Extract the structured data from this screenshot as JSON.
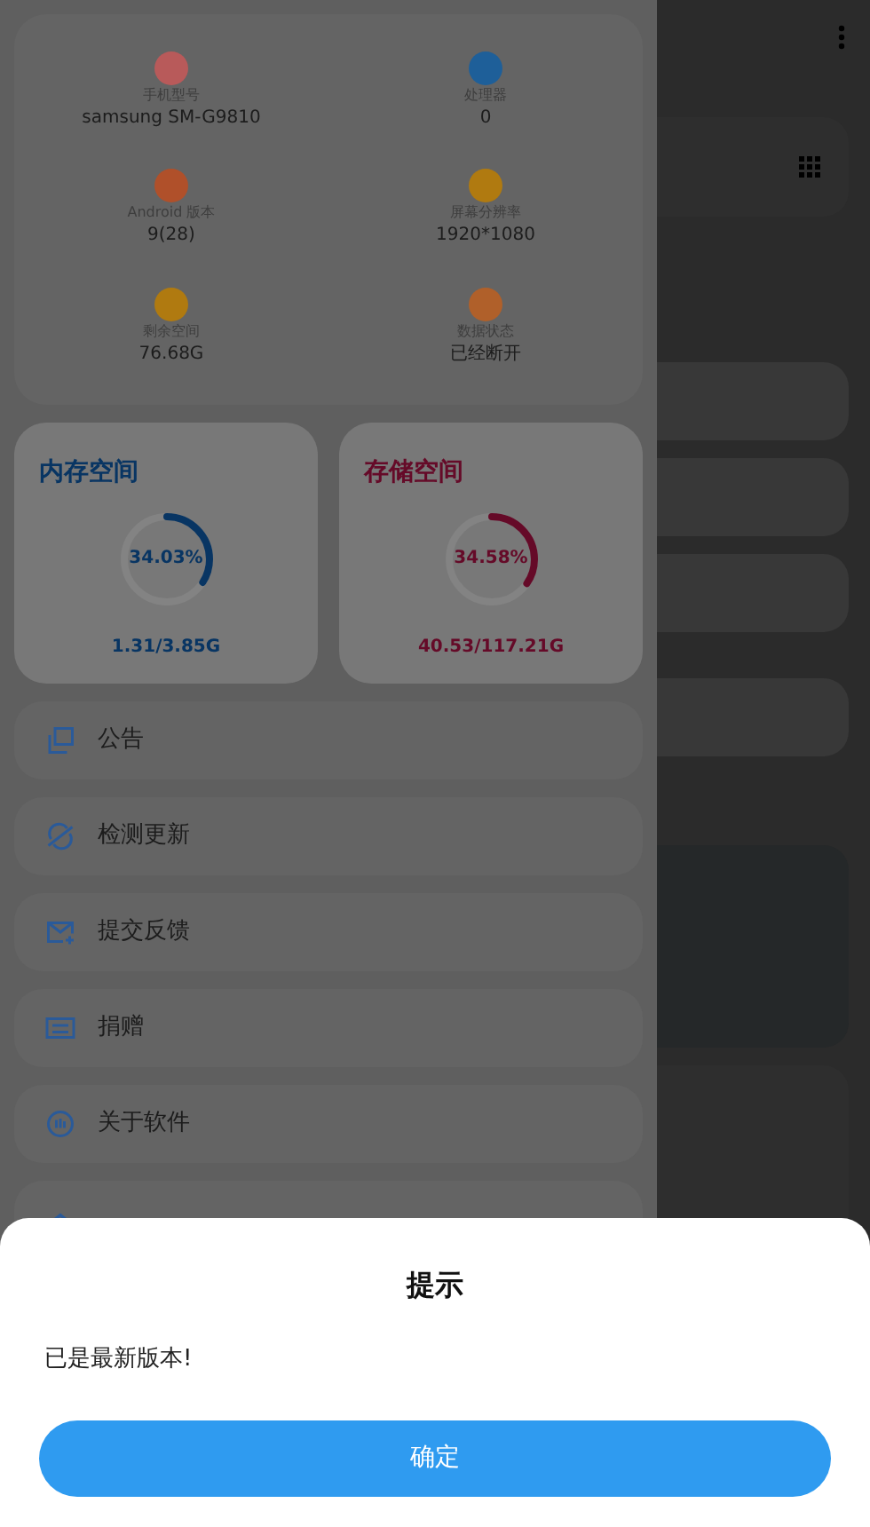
{
  "device_info": [
    {
      "label": "手机型号",
      "value": "samsung SM-G9810",
      "color": "#b85a5a"
    },
    {
      "label": "处理器",
      "value": "0",
      "color": "#1e5f99"
    },
    {
      "label": "Android 版本",
      "value": "9(28)",
      "color": "#b0502a"
    },
    {
      "label": "屏幕分辨率",
      "value": "1920*1080",
      "color": "#b07a10"
    },
    {
      "label": "剩余空间",
      "value": "76.68G",
      "color": "#b07a10"
    },
    {
      "label": "数据状态",
      "value": "已经断开",
      "color": "#b0602a"
    }
  ],
  "usage": [
    {
      "title": "内存空间",
      "percent": "34.03%",
      "level": 0.3403,
      "amount": "1.31/3.85G",
      "color": "#083563"
    },
    {
      "title": "存储空间",
      "percent": "34.58%",
      "level": 0.3458,
      "amount": "40.53/117.21G",
      "color": "#650a28"
    }
  ],
  "menu": [
    {
      "label": "公告",
      "kind": "notice"
    },
    {
      "label": "检测更新",
      "kind": "update"
    },
    {
      "label": "提交反馈",
      "kind": "feedback"
    },
    {
      "label": "捐赠",
      "kind": "donate"
    },
    {
      "label": "关于软件",
      "kind": "about"
    },
    {
      "kind": "premium"
    }
  ],
  "dialog": {
    "title": "提示",
    "message": "已是最新版本!",
    "button": "确定"
  }
}
